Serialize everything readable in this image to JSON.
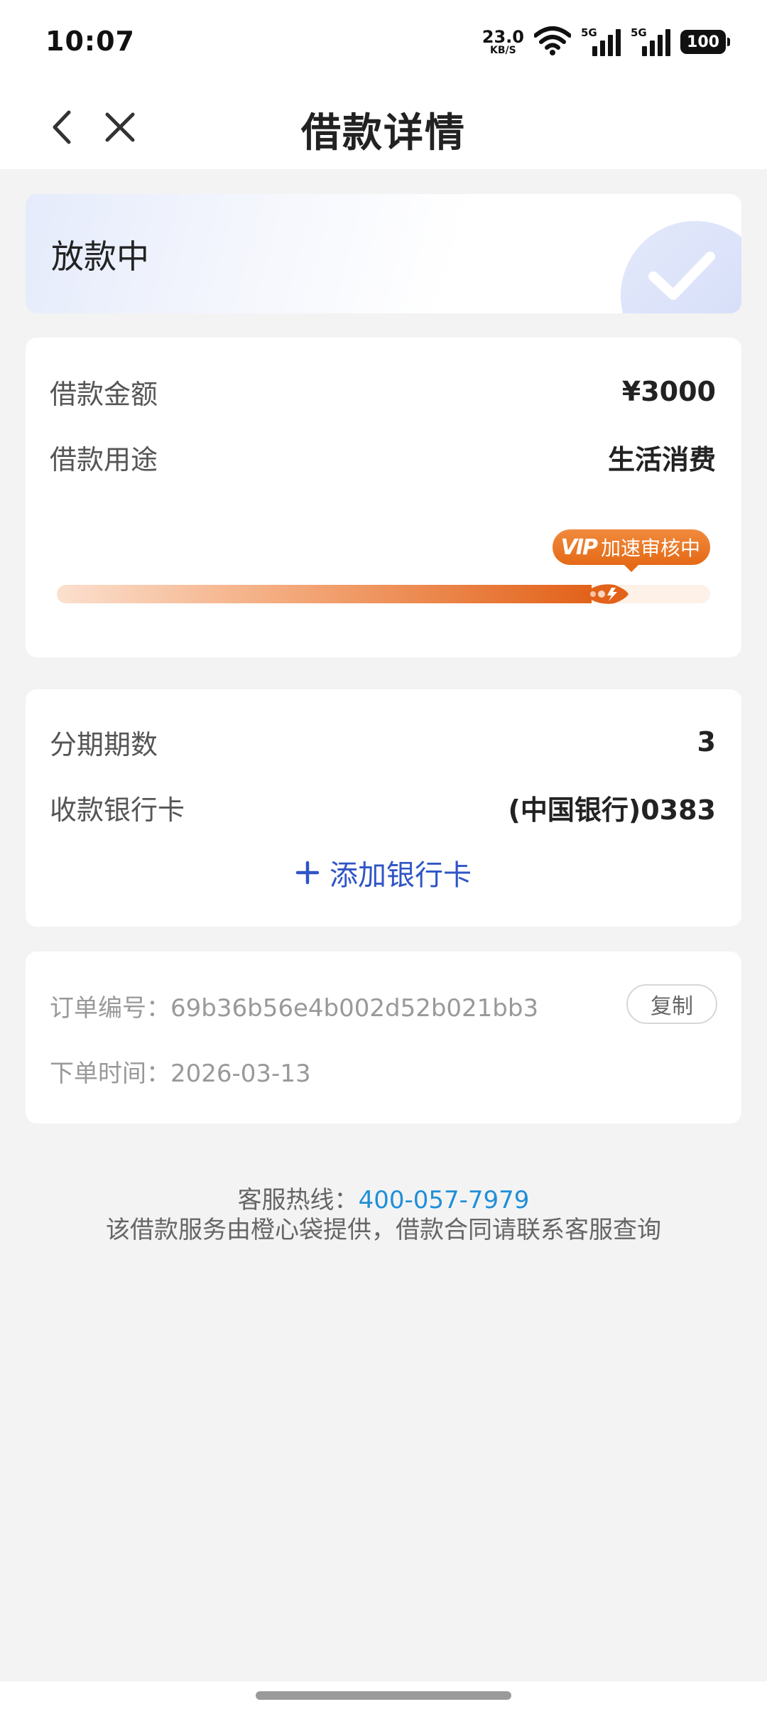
{
  "status_bar": {
    "time": "10:07",
    "net_speed_value": "23.0",
    "net_speed_unit": "KB/S",
    "signal_1_tag": "5G",
    "signal_2_tag": "5G",
    "battery": "100",
    "icons": [
      "wifi-icon",
      "signal-icon",
      "signal-icon",
      "battery-icon"
    ]
  },
  "nav": {
    "title": "借款详情",
    "back_icon": "chevron-left-icon",
    "close_icon": "close-icon"
  },
  "status_card": {
    "status": "放款中",
    "decor_icon": "check-circle-icon"
  },
  "loan_info": {
    "amount_label": "借款金额",
    "amount_value": "¥3000",
    "purpose_label": "借款用途",
    "purpose_value": "生活消费"
  },
  "progress": {
    "badge_mark": "VIP",
    "badge_text": "加速审核中",
    "fraction": 0.93,
    "fill_color": "#e2621a"
  },
  "repayment": {
    "installments_label": "分期期数",
    "installments_value": "3",
    "bank_label": "收款银行卡",
    "bank_value": "(中国银行)0383",
    "add_bank_label": "添加银行卡",
    "add_bank_icon": "plus-icon"
  },
  "order": {
    "order_no_label": "订单编号：",
    "order_no_value": "69b36b56e4b002d52b021bb3",
    "copy_label": "复制",
    "order_time_label": "下单时间：",
    "order_time_value": "2026-03-13"
  },
  "footer": {
    "hotline_label": "客服热线：",
    "hotline_number": "400-057-7979",
    "notice": "该借款服务由橙心袋提供，借款合同请联系客服查询"
  },
  "colors": {
    "accent_blue": "#2f55c6",
    "link_blue": "#1f8fd8",
    "orange": "#e46a16"
  }
}
